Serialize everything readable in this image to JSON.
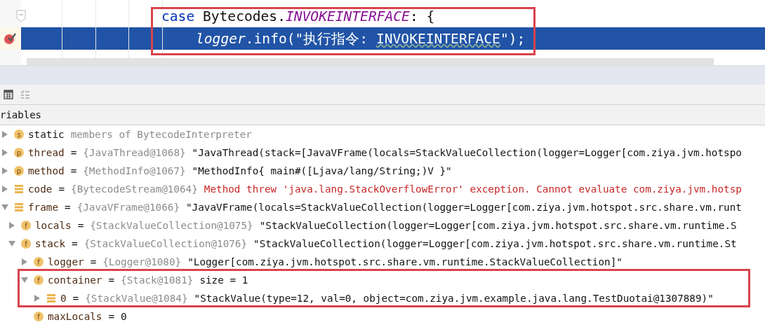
{
  "editor": {
    "lines": [
      {
        "selected": false,
        "breakpoint": false,
        "fold": true,
        "segments": [
          {
            "text": "case",
            "kind": "keyword"
          },
          {
            "text": " Bytecodes.",
            "kind": "plain"
          },
          {
            "text": "INVOKEINTERFACE",
            "kind": "constant"
          },
          {
            "text": ": {",
            "kind": "plain"
          }
        ],
        "children": [
          {
            "selected": true,
            "breakpoint": true,
            "fold": false,
            "segments": [
              {
                "text": "logger",
                "kind": "field"
              },
              {
                "text": ".info(",
                "kind": "plain"
              },
              {
                "text": "\"执行指令: ",
                "kind": "string"
              },
              {
                "text": "INVOKEINTERFACE",
                "kind": "typo"
              },
              {
                "text": "\"",
                "kind": "string"
              },
              {
                "text": ");",
                "kind": "plain"
              }
            ]
          }
        ]
      }
    ]
  },
  "toolbar": {
    "buttons": [
      {
        "kind": "calculator",
        "disabled": false
      },
      {
        "kind": "list",
        "disabled": true
      }
    ]
  },
  "variables": {
    "title": "riables",
    "items": [
      {
        "kind": "static",
        "icon": {
          "kind": "letter",
          "letter": "s"
        },
        "expanded": false,
        "label": "static",
        "type": "members of BytecodeInterpreter"
      },
      {
        "kind": "value",
        "icon": {
          "kind": "letter",
          "letter": "p"
        },
        "expanded": false,
        "label": "thread",
        "op": "=",
        "type": "{JavaThread@1068}",
        "value": "\"JavaThread(stack=[JavaVFrame(locals=StackValueCollection(logger=Logger[com.ziya.jvm.hotspo"
      },
      {
        "kind": "value",
        "icon": {
          "kind": "letter",
          "letter": "p"
        },
        "expanded": false,
        "label": "method",
        "op": "=",
        "type": "{MethodInfo@1067}",
        "value": "\"MethodInfo{ main#([Ljava/lang/String;)V }\""
      },
      {
        "kind": "error",
        "icon": {
          "kind": "bars"
        },
        "expanded": false,
        "label": "code",
        "op": "=",
        "type": "{BytecodeStream@1064}",
        "value": "Method threw 'java.lang.StackOverflowError' exception. Cannot evaluate com.ziya.jvm.hotsp"
      },
      {
        "kind": "value",
        "icon": {
          "kind": "bars"
        },
        "expanded": true,
        "label": "frame",
        "op": "=",
        "type": "{JavaVFrame@1066}",
        "value": "\"JavaVFrame(locals=StackValueCollection(logger=Logger[com.ziya.jvm.hotspot.src.share.vm.runt",
        "children": [
          {
            "kind": "value",
            "icon": {
              "kind": "letter",
              "letter": "f"
            },
            "expanded": false,
            "label": "locals",
            "op": "=",
            "type": "{StackValueCollection@1075}",
            "value": "\"StackValueCollection(logger=Logger[com.ziya.jvm.hotspot.src.share.vm.runtime.S"
          },
          {
            "kind": "value",
            "icon": {
              "kind": "letter",
              "letter": "f"
            },
            "expanded": true,
            "label": "stack",
            "op": "=",
            "type": "{StackValueCollection@1076}",
            "value": "\"StackValueCollection(logger=Logger[com.ziya.jvm.hotspot.src.share.vm.runtime.St",
            "children": [
              {
                "kind": "value",
                "icon": {
                  "kind": "letter",
                  "letter": "f"
                },
                "expanded": false,
                "label": "logger",
                "op": "=",
                "type": "{Logger@1080}",
                "value": "\"Logger[com.ziya.jvm.hotspot.src.share.vm.runtime.StackValueCollection]\""
              },
              {
                "kind": "value",
                "icon": {
                  "kind": "letter",
                  "letter": "f"
                },
                "expanded": true,
                "label": "container",
                "op": "=",
                "type": "{Stack@1081}",
                "value": "size = 1",
                "children": [
                  {
                    "kind": "value",
                    "icon": {
                      "kind": "bars"
                    },
                    "expanded": false,
                    "label": "0",
                    "op": "=",
                    "type": "{StackValue@1084}",
                    "value": "\"StackValue(type=12, val=0, object=com.ziya.jvm.example.java.lang.TestDuotai@1307889)\""
                  }
                ]
              },
              {
                "kind": "value",
                "icon": {
                  "kind": "letter",
                  "letter": "f"
                },
                "label": "maxLocals",
                "op": "=",
                "value": "0"
              }
            ]
          }
        ]
      }
    ]
  }
}
